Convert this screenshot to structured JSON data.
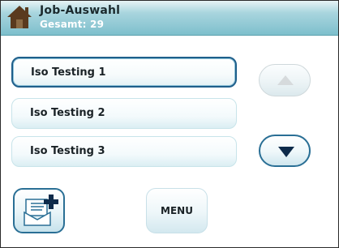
{
  "header": {
    "title": "Job-Auswahl",
    "subtitle": "Gesamt: 29"
  },
  "job_list": {
    "items": [
      {
        "label": "Iso Testing 1",
        "selected": true
      },
      {
        "label": "Iso Testing 2",
        "selected": false
      },
      {
        "label": "Iso Testing 3",
        "selected": false
      }
    ]
  },
  "controls": {
    "menu_label": "MENU",
    "scroll_up_icon": "triangle-up-icon",
    "scroll_down_icon": "triangle-down-icon",
    "new_job_icon": "document-plus-icon",
    "home_icon": "home-icon"
  },
  "colors": {
    "accent": "#1f5f8b",
    "header_bg": "#7dbfcc",
    "arrow_dark": "#0d2a4a"
  }
}
